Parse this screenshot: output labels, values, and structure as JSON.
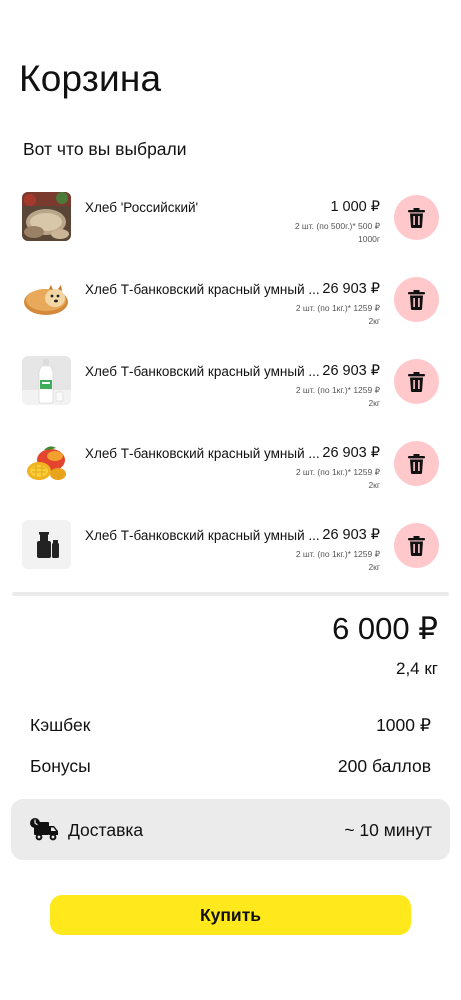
{
  "header": {
    "title": "Корзина",
    "subtitle": "Вот что вы выбрали"
  },
  "items": [
    {
      "name": "Хлеб 'Российский'",
      "price": "1 000 ₽",
      "detail": "2 шт. (по 500г.)* 500 ₽",
      "weight": "1000г",
      "image": "bread-slices-image"
    },
    {
      "name": "Хлеб Т-банковский красный умный ...",
      "price": "26 903 ₽",
      "detail": "2 шт. (по 1кг.)* 1259 ₽",
      "weight": "2кг",
      "image": "doge-bread-image"
    },
    {
      "name": "Хлеб Т-банковский красный умный ...",
      "price": "26 903 ₽",
      "detail": "2 шт. (по 1кг.)* 1259 ₽",
      "weight": "2кг",
      "image": "milk-bottle-image"
    },
    {
      "name": "Хлеб Т-банковский красный умный ...",
      "price": "26 903 ₽",
      "detail": "2 шт. (по 1кг.)* 1259 ₽",
      "weight": "2кг",
      "image": "mango-image"
    },
    {
      "name": "Хлеб Т-банковский красный умный ...",
      "price": "26 903 ₽",
      "detail": "2 шт. (по 1кг.)* 1259 ₽",
      "weight": "2кг",
      "image": "bottle-placeholder-image"
    }
  ],
  "summary": {
    "total": "6 000 ₽",
    "total_weight": "2,4 кг"
  },
  "cashback": {
    "label": "Кэшбек",
    "value": "1000 ₽"
  },
  "bonus": {
    "label": "Бонусы",
    "value": "200 баллов"
  },
  "delivery": {
    "label": "Доставка",
    "time": "~ 10 минут",
    "icon": "delivery-truck-icon"
  },
  "buy_button": {
    "label": "Купить"
  },
  "colors": {
    "accent": "#ffe91c",
    "delete_bg": "#ffc9cc",
    "panel_bg": "#ebebeb"
  }
}
